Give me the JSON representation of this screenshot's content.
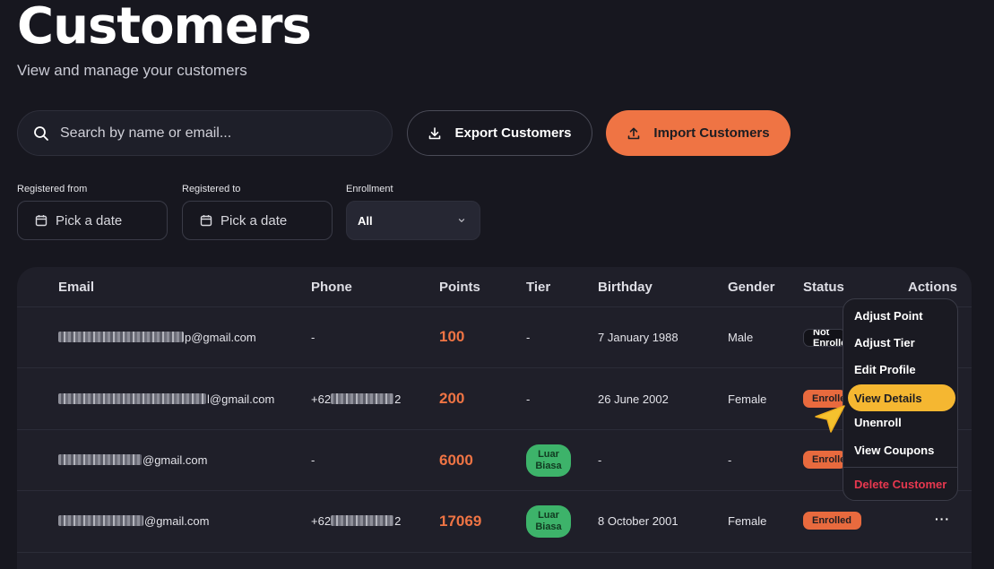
{
  "header": {
    "title": "Customers",
    "subtitle": "View and manage your customers"
  },
  "search": {
    "placeholder": "Search by name or email..."
  },
  "buttons": {
    "export_label": "Export Customers",
    "import_label": "Import Customers"
  },
  "filters": {
    "registered_from_label": "Registered from",
    "registered_to_label": "Registered to",
    "enrollment_label": "Enrollment",
    "date_placeholder": "Pick a date",
    "enrollment_value": "All"
  },
  "table": {
    "columns": {
      "email": "Email",
      "phone": "Phone",
      "points": "Points",
      "tier": "Tier",
      "birthday": "Birthday",
      "gender": "Gender",
      "status": "Status",
      "actions": "Actions"
    },
    "rows": [
      {
        "email_suffix": "p@gmail.com",
        "phone": "-",
        "phone_suffix": "",
        "points": "100",
        "tier": "-",
        "birthday": "7 January 1988",
        "gender": "Male",
        "status": "Not Enrolled"
      },
      {
        "email_suffix": "l@gmail.com",
        "phone": "+62",
        "phone_suffix": "2",
        "points": "200",
        "tier": "-",
        "birthday": "26 June 2002",
        "gender": "Female",
        "status": "Enrolled"
      },
      {
        "email_suffix": "@gmail.com",
        "phone": "-",
        "phone_suffix": "",
        "points": "6000",
        "tier": "Luar Biasa",
        "birthday": "-",
        "gender": "-",
        "status": "Enrolled"
      },
      {
        "email_suffix": "@gmail.com",
        "phone": "+62",
        "phone_suffix": "2",
        "points": "17069",
        "tier": "Luar Biasa",
        "birthday": "8 October 2001",
        "gender": "Female",
        "status": "Enrolled"
      }
    ],
    "actions_glyph": "···"
  },
  "action_menu": {
    "items": [
      "Adjust Point",
      "Adjust Tier",
      "Edit Profile",
      "View Details",
      "Unenroll",
      "View Coupons"
    ],
    "danger_item": "Delete Customer",
    "active_item": "View Details"
  },
  "colors": {
    "accent": "#ef7444",
    "menu_highlight": "#f5b731",
    "tier_badge": "#3db36a",
    "danger": "#e8384f"
  }
}
